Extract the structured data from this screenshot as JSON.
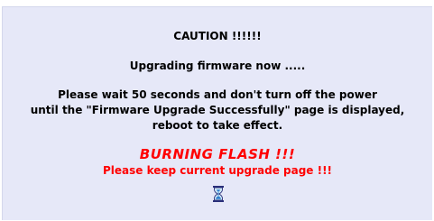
{
  "caution": "CAUTION !!!!!!",
  "upgrading": "Upgrading firmware now .....",
  "instructions": {
    "line1": "Please wait 50 seconds and don't turn off the power",
    "line2": "until the \"Firmware Upgrade Successfully\" page is displayed,",
    "line3": "reboot to take effect."
  },
  "burning": "BURNING FLASH !!!",
  "keep_page": "Please keep current upgrade page !!!",
  "icons": {
    "progress": "hourglass-icon"
  },
  "colors": {
    "background": "#e6e8f8",
    "warning": "#ff0000",
    "text": "#000000"
  }
}
